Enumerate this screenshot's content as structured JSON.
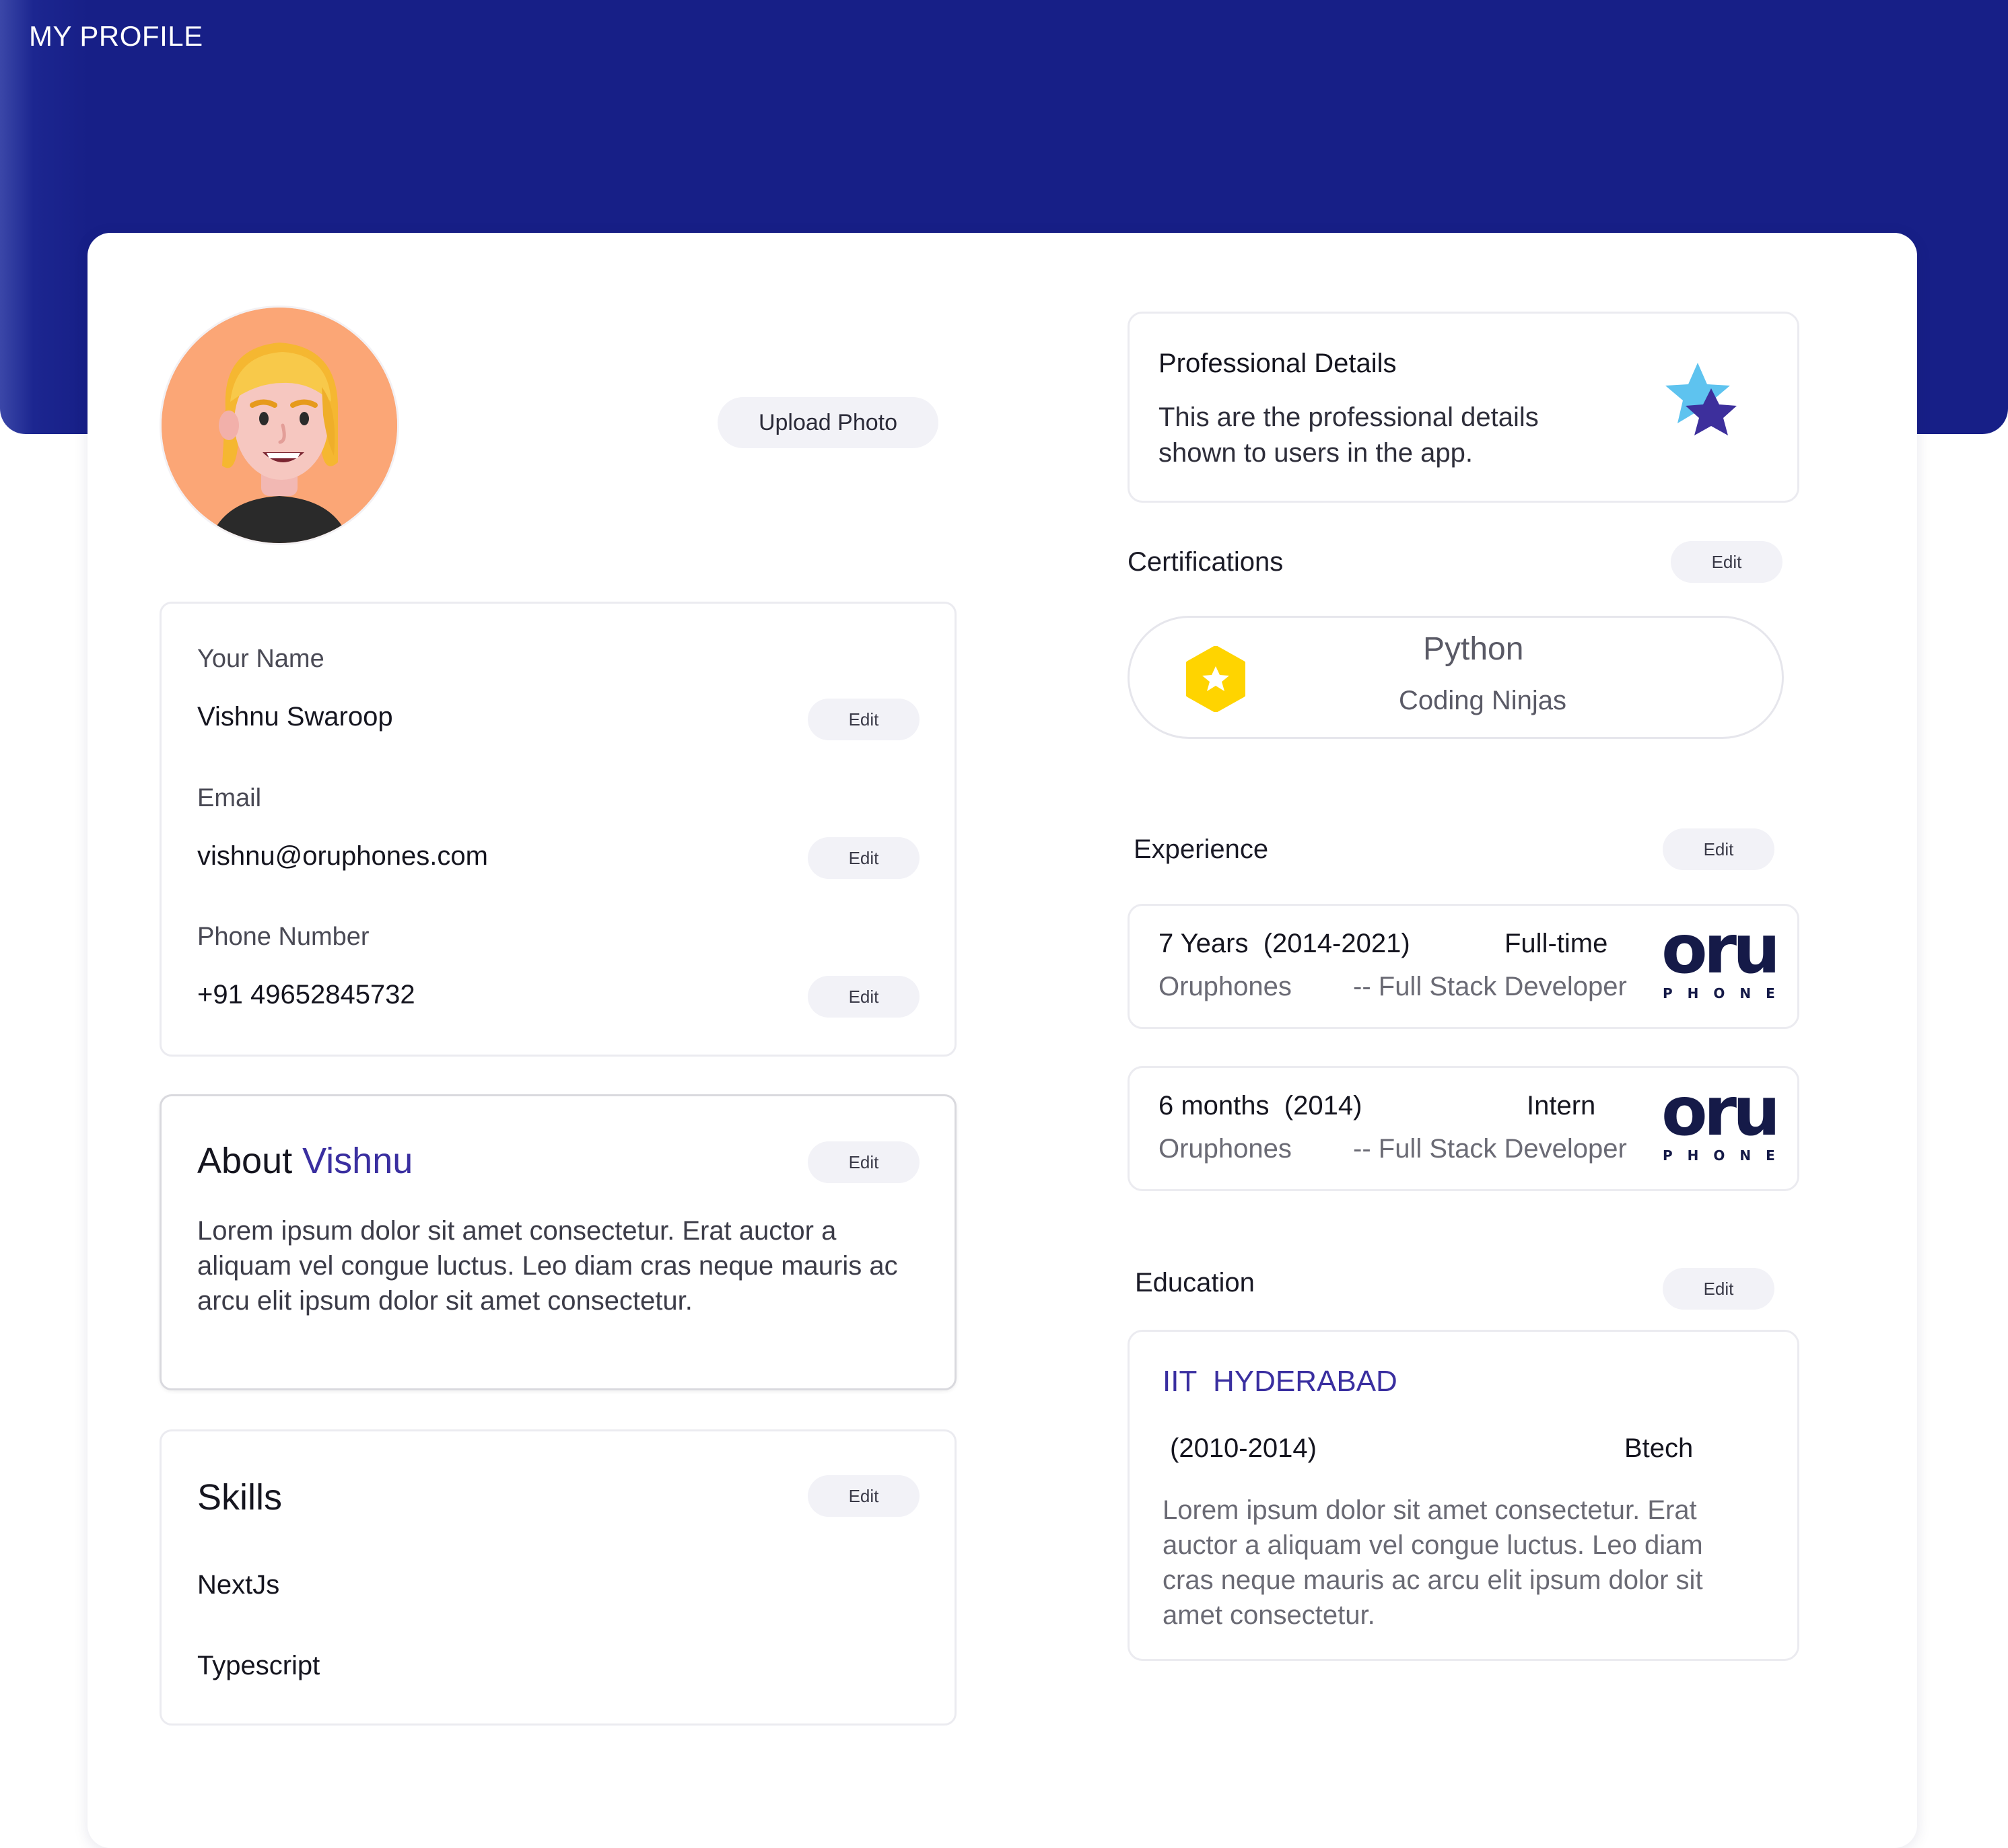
{
  "header": {
    "title": "MY PROFILE"
  },
  "profile": {
    "upload_label": "Upload Photo"
  },
  "contact": {
    "name_label": "Your Name",
    "name_value": "Vishnu Swaroop",
    "email_label": "Email",
    "email_value": "vishnu@oruphones.com",
    "phone_label": "Phone Number",
    "phone_value": "+91 49652845732",
    "edit_label": "Edit"
  },
  "about": {
    "title_prefix": "About",
    "title_name": "Vishnu",
    "text": "Lorem ipsum dolor sit amet consectetur. Erat auctor a aliquam vel congue luctus. Leo diam cras neque mauris ac arcu elit ipsum dolor sit amet consectetur.",
    "edit_label": "Edit"
  },
  "skills": {
    "title": "Skills",
    "edit_label": "Edit",
    "items": [
      "NextJs",
      "Typescript"
    ]
  },
  "professional": {
    "title": "Professional Details",
    "description": "This are the professional details shown to users in the app.",
    "icon": "star-icon"
  },
  "certifications": {
    "title": "Certifications",
    "edit_label": "Edit",
    "items": [
      {
        "name": "Python",
        "issuer": "Coding Ninjas",
        "icon": "badge-star-icon"
      }
    ]
  },
  "experience": {
    "title": "Experience",
    "edit_label": "Edit",
    "items": [
      {
        "duration": "7 Years",
        "period": "(2014-2021)",
        "type": "Full-time",
        "company": "Oruphones",
        "role": "-- Full Stack Developer",
        "logo_main": "oru",
        "logo_sub": "PHONES"
      },
      {
        "duration": "6 months",
        "period": "(2014)",
        "type": "Intern",
        "company": "Oruphones",
        "role": "-- Full Stack Developer",
        "logo_main": "oru",
        "logo_sub": "PHONES"
      }
    ]
  },
  "education": {
    "title": "Education",
    "edit_label": "Edit",
    "school": "IIT  HYDERABAD",
    "period": "(2010-2014)",
    "degree": "Btech",
    "description": "Lorem ipsum dolor sit amet consectetur. Erat auctor a aliquam vel congue luctus. Leo diam cras neque mauris ac arcu elit ipsum dolor sit amet consectetur."
  },
  "colors": {
    "header_blue": "#171f87",
    "accent_purple": "#3a2fa0",
    "avatar_bg": "#fba676",
    "badge_yellow": "#ffd400"
  }
}
